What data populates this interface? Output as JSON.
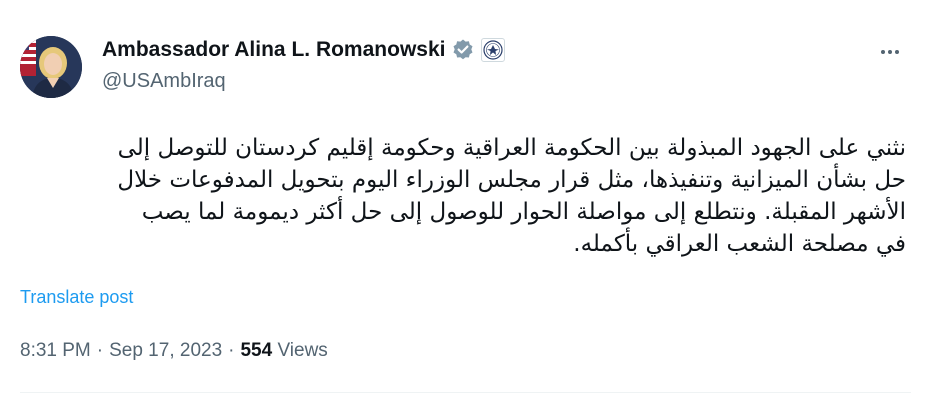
{
  "author": {
    "display_name": "Ambassador Alina L. Romanowski",
    "handle": "@USAmbIraq",
    "verified_icon": "verified-badge-icon",
    "affiliation_icon": "us-seal-icon"
  },
  "post": {
    "text_lines": [
      "نثني على الجهود المبذولة بين الحكومة العراقية وحكومة إقليم كردستان للتوصل إلى",
      "حل بشأن الميزانية وتنفيذها، مثل قرار مجلس الوزراء اليوم بتحويل المدفوعات خلال",
      "الأشهر المقبلة. ونتطلع إلى مواصلة الحوار للوصول إلى حل أكثر ديمومة لما يصب",
      "في مصلحة الشعب العراقي بأكمله."
    ],
    "translate_label": "Translate post"
  },
  "meta": {
    "time": "8:31 PM",
    "separator": "·",
    "date": "Sep 17, 2023",
    "views_count": "554",
    "views_label": "Views"
  },
  "colors": {
    "text": "#0f1419",
    "secondary": "#536471",
    "link": "#1d9bf0",
    "verified": "#829aab"
  }
}
